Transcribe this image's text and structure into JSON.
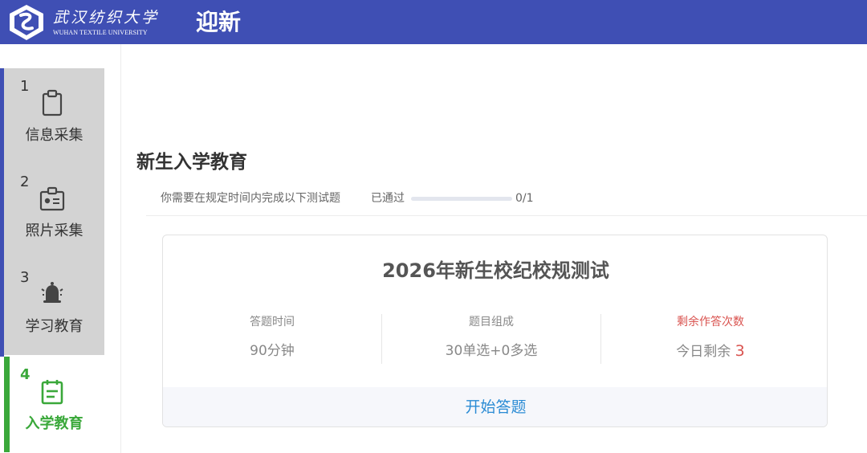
{
  "header": {
    "logo_cn": "武汉纺织大学",
    "logo_en": "WUHAN TEXTILE UNIVERSITY",
    "app_title": "迎新"
  },
  "sidebar": {
    "steps": [
      {
        "num": "1",
        "label": "信息采集",
        "icon": "clipboard-icon",
        "active": false
      },
      {
        "num": "2",
        "label": "照片采集",
        "icon": "id-card-icon",
        "active": false
      },
      {
        "num": "3",
        "label": "学习教育",
        "icon": "bell-icon",
        "active": false
      },
      {
        "num": "4",
        "label": "入学教育",
        "icon": "calendar-icon",
        "active": true
      }
    ]
  },
  "main": {
    "title": "新生入学教育",
    "description": "你需要在规定时间内完成以下测试题",
    "passed_label": "已通过",
    "progress": 0,
    "progress_text": "0/1"
  },
  "exam": {
    "title": "2026年新生校纪校规测试",
    "stats": [
      {
        "label": "答题时间",
        "value": "90分钟"
      },
      {
        "label": "题目组成",
        "value": "30单选+0多选"
      },
      {
        "label": "剩余作答次数",
        "value_prefix": "今日剩余",
        "value_number": "3"
      }
    ],
    "start_label": "开始答题"
  },
  "colors": {
    "header_bg": "#3f4fb4",
    "active_step": "#3aa83a",
    "inactive_step_bg": "#d3d3d3",
    "highlight_red": "#d9534f",
    "link_blue": "#2a8bd4"
  }
}
